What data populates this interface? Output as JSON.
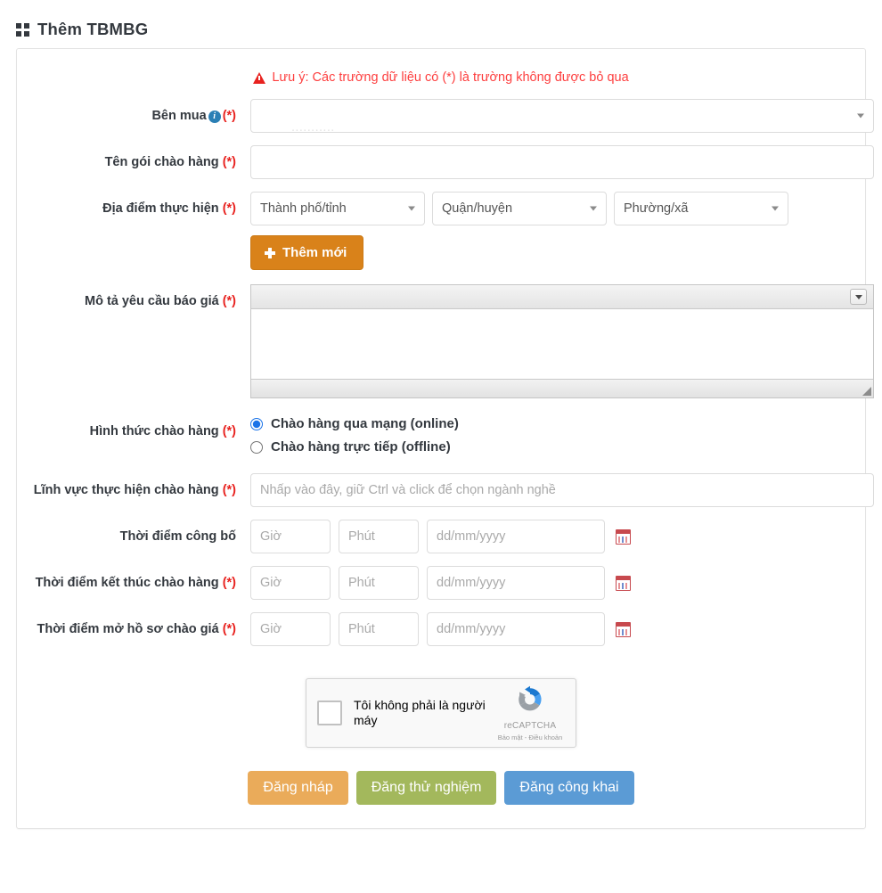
{
  "header": {
    "icon": "grid-2x2-icon",
    "title": "Thêm TBMBG"
  },
  "notice": {
    "icon": "warning-triangle-icon",
    "text": "Lưu ý: Các trường dữ liệu có (*) là trường không được bỏ qua"
  },
  "form": {
    "buyer": {
      "label": "Bên mua",
      "info_icon": "info-circle-icon",
      "required_mark": "(*)",
      "value": "",
      "faded_value": "..........."
    },
    "package_name": {
      "label": "Tên gói chào hàng",
      "required_mark": "(*)",
      "value": "",
      "placeholder": ""
    },
    "location": {
      "label": "Địa điểm thực hiện",
      "required_mark": "(*)",
      "province_placeholder": "Thành phố/tỉnh",
      "district_placeholder": "Quận/huyện",
      "ward_placeholder": "Phường/xã",
      "add_button": "Thêm mới",
      "add_button_icon": "plus-icon"
    },
    "quote_description": {
      "label": "Mô tả yêu cầu báo giá",
      "required_mark": "(*)",
      "value": "",
      "toolbar_icon": "toolbar-dropdown-icon",
      "resize_icon": "resize-grip-icon"
    },
    "offer_type": {
      "label": "Hình thức chào hàng",
      "required_mark": "(*)",
      "options": [
        {
          "label": "Chào hàng qua mạng (online)",
          "selected": true
        },
        {
          "label": "Chào hàng trực tiếp (offline)",
          "selected": false
        }
      ]
    },
    "sector": {
      "label": "Lĩnh vực thực hiện chào hàng",
      "required_mark": "(*)",
      "placeholder": "Nhấp vào đây, giữ Ctrl và click để chọn ngành nghề",
      "value": ""
    },
    "publish_time": {
      "label": "Thời điểm công bố",
      "required_mark": "",
      "hour_placeholder": "Giờ",
      "minute_placeholder": "Phút",
      "date_placeholder": "dd/mm/yyyy",
      "calendar_icon": "calendar-icon"
    },
    "end_time": {
      "label": "Thời điểm kết thúc chào hàng",
      "required_mark": "(*)",
      "hour_placeholder": "Giờ",
      "minute_placeholder": "Phút",
      "date_placeholder": "dd/mm/yyyy",
      "calendar_icon": "calendar-icon"
    },
    "open_time": {
      "label": "Thời điểm mở hồ sơ chào giá",
      "required_mark": "(*)",
      "hour_placeholder": "Giờ",
      "minute_placeholder": "Phút",
      "date_placeholder": "dd/mm/yyyy",
      "calendar_icon": "calendar-icon"
    }
  },
  "captcha": {
    "checkbox_label": "Tôi không phải là người máy",
    "brand": "reCAPTCHA",
    "links": "Bảo mật - Điều khoản",
    "logo_icon": "recaptcha-logo-icon"
  },
  "actions": {
    "draft": "Đăng nháp",
    "test": "Đăng thử nghiệm",
    "public": "Đăng công khai"
  },
  "colors": {
    "required": "#e8221f",
    "notice": "#fd3e3e",
    "add_button": "#d9821a",
    "draft_button": "#eaab5a",
    "test_button": "#a3b85c",
    "public_button": "#5b9bd5",
    "info_icon": "#2a7fb5",
    "title": "#34393f"
  }
}
